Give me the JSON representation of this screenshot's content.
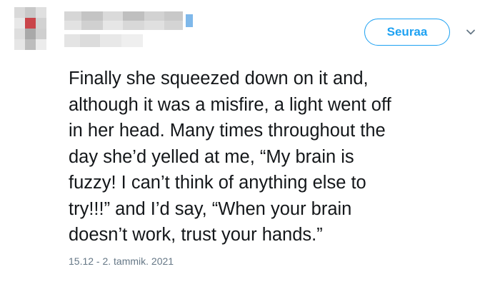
{
  "tweet": {
    "follow_label": "Seuraa",
    "text_lines": [
      "Finally she squeezed down on it and,",
      "although it was a misfire, a light went off",
      "in her head. Many times throughout the",
      "day she’d yelled at me, “My brain is",
      "fuzzy! I can’t think of anything else to",
      "try!!!” and I’d say, “When your brain",
      "doesn’t work, trust your hands.”"
    ],
    "timestamp": "15.12 - 2. tammik. 2021"
  },
  "colors": {
    "accent": "#1da1f2",
    "text": "#14171a",
    "muted": "#657786"
  },
  "icons": {
    "menu": "chevron-down-icon"
  }
}
